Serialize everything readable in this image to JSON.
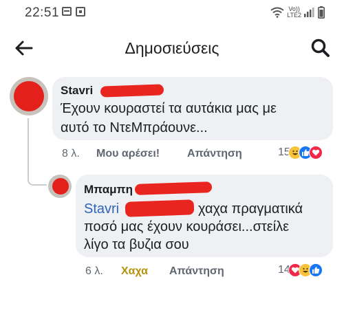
{
  "status_bar": {
    "time": "22:51",
    "network": "Vo))\nLTE2"
  },
  "app_bar": {
    "title": "Δημοσιεύσεις"
  },
  "comments": [
    {
      "author": "Stavri",
      "text_line1": "Έχουν κουραστεί τα αυτάκια μας με",
      "text_line2": "αυτό το ΝτεΜπράουνε...",
      "time": "8 λ.",
      "like_label": "Μου αρέσει!",
      "reply_label": "Απάντηση",
      "reaction_count": "15",
      "reactions": [
        "haha-icon",
        "like-icon",
        "love-icon"
      ]
    },
    {
      "author": "Μπαμπη",
      "mention": "Stavri",
      "text_line1_rest": "χαχα πραγματικά",
      "text_line2": "ποσό μας έχουν κουράσει...στείλε",
      "text_line3": "λίγο τα βυζια σου",
      "time": "6 λ.",
      "reaction_label": "Χαχα",
      "reply_label": "Απάντηση",
      "reaction_count": "14",
      "reactions": [
        "love-icon",
        "haha-icon",
        "like-icon"
      ]
    }
  ],
  "colors": {
    "mention": "#2d64bc",
    "haha_active": "#b8920e",
    "redaction": "#e8251f"
  }
}
